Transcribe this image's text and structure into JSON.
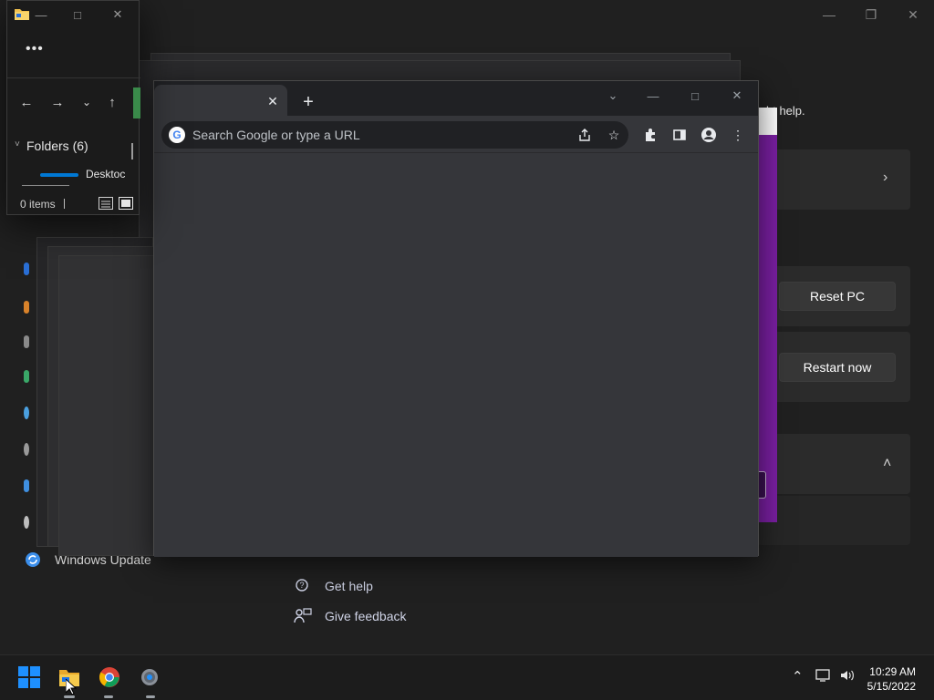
{
  "settings": {
    "partial_text": "ht help.",
    "reset_pc_label": "Reset PC",
    "restart_now_label": "Restart now",
    "windows_update_label": "Windows Update",
    "get_help_label": "Get help",
    "give_feedback_label": "Give feedback"
  },
  "chrome": {
    "omnibox_placeholder": "Search Google or type a URL"
  },
  "explorer": {
    "folders_label": "Folders (6)",
    "desktop_label": "Desktoc",
    "status_items": "0 items"
  },
  "taskbar": {
    "time": "10:29 AM",
    "date": "5/15/2022",
    "pinned": [
      "windows-start",
      "file-explorer",
      "chrome",
      "settings"
    ]
  },
  "colors": {
    "accent_purple": "#7a1fa2",
    "windows_blue": "#0078d4",
    "update_blue": "#3b8eea"
  }
}
